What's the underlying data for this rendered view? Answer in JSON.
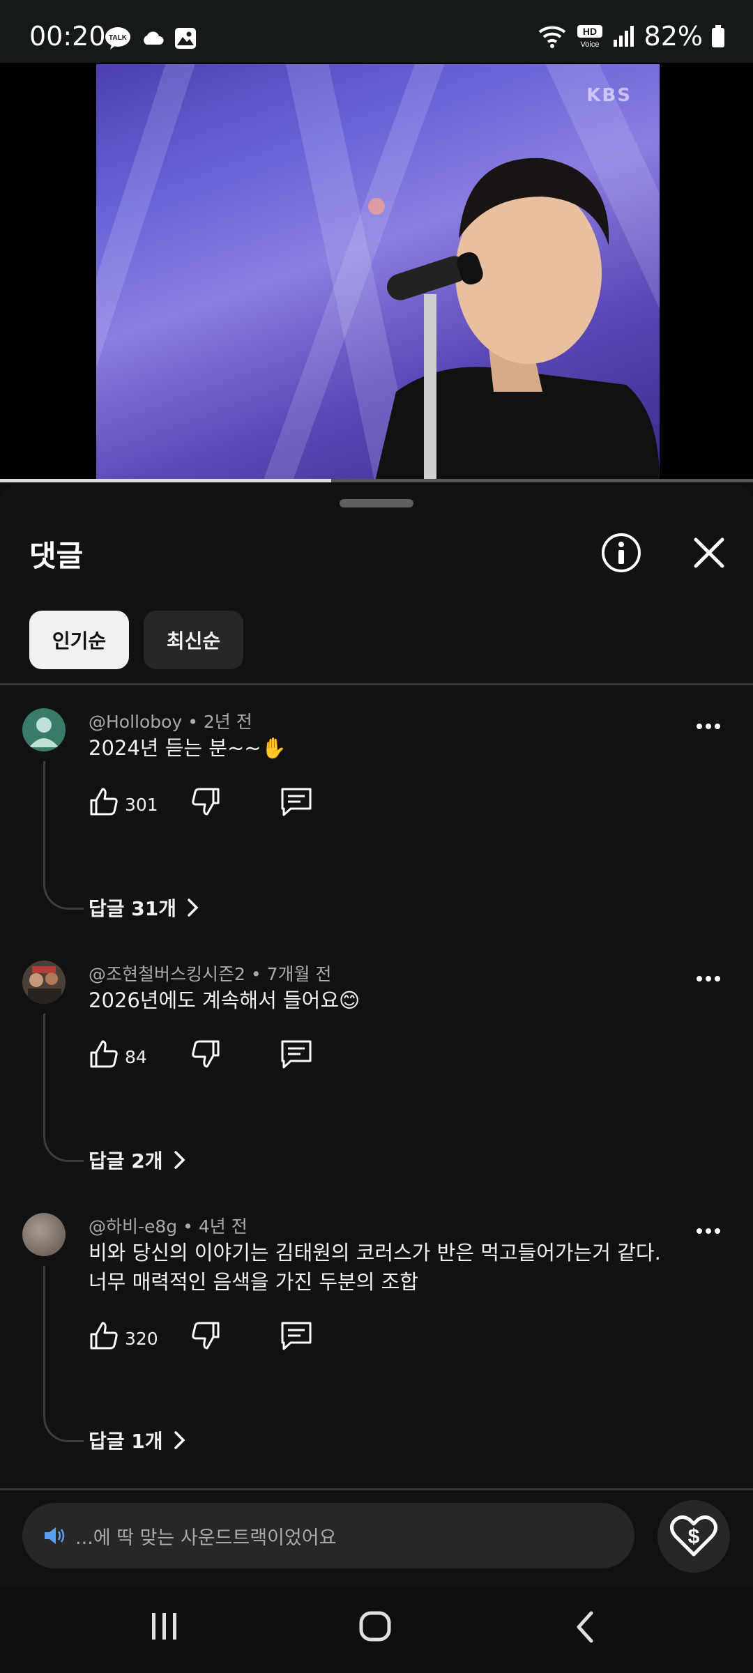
{
  "status_bar": {
    "time": "00:20",
    "battery": "82%",
    "hd_label": "HD",
    "voice_label": "Voice",
    "talk_label": "TALK"
  },
  "video": {
    "watermark": "KBS",
    "progress": 0.44
  },
  "comments_panel": {
    "title": "댓글",
    "sort_chips": [
      "인기순",
      "최신순"
    ],
    "selected_sort": "인기순"
  },
  "comments": [
    {
      "author": "@Holloboy",
      "time": "2년 전",
      "text_lines": [
        "2024년 듣는 분~~✋"
      ],
      "likes": "301",
      "replies": "답글 31개"
    },
    {
      "author": "@조현철버스킹시즌2",
      "time": "7개월 전",
      "text_lines": [
        "2026년에도 계속해서 들어요😊"
      ],
      "likes": "84",
      "replies": "답글 2개"
    },
    {
      "author": "@하비-e8g",
      "time": "4년 전",
      "text_lines": [
        "비와 당신의 이야기는 김태원의 코러스가 반은 먹고들어가는거 같다.",
        "너무 매력적인 음색을 가진 두분의 조합"
      ],
      "likes": "320",
      "replies": "답글 1개"
    }
  ],
  "input": {
    "placeholder": "...에 딱 맞는 사운드트랙이었어요"
  },
  "colors": {
    "background": "#0f0f0f",
    "chip_active": "#f1f1f1",
    "chip_inactive": "#272727",
    "secondary_text": "#aaaaaa"
  }
}
